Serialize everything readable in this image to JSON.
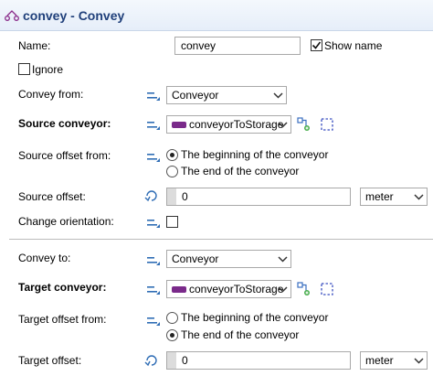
{
  "header": {
    "title": "convey - Convey",
    "icon": "convey-block-icon"
  },
  "name_row": {
    "label": "Name:",
    "value": "convey",
    "show_name_label": "Show name",
    "show_name_checked": true
  },
  "ignore": {
    "label": "Ignore",
    "checked": false
  },
  "convey_from": {
    "label": "Convey from:",
    "value": "Conveyor"
  },
  "source_conveyor": {
    "label": "Source conveyor:",
    "value": "conveyorToStorage"
  },
  "source_offset_from": {
    "label": "Source offset from:",
    "options": [
      "The beginning of the conveyor",
      "The end of the conveyor"
    ],
    "selected": 0
  },
  "source_offset": {
    "label": "Source offset:",
    "value": "0",
    "unit": "meter"
  },
  "change_orientation": {
    "label": "Change orientation:",
    "checked": false
  },
  "convey_to": {
    "label": "Convey to:",
    "value": "Conveyor"
  },
  "target_conveyor": {
    "label": "Target conveyor:",
    "value": "conveyorToStorage"
  },
  "target_offset_from": {
    "label": "Target offset from:",
    "options": [
      "The beginning of the conveyor",
      "The end of the conveyor"
    ],
    "selected": 1
  },
  "target_offset": {
    "label": "Target offset:",
    "value": "0",
    "unit": "meter"
  },
  "colors": {
    "title": "#1f3f7a",
    "header_bg": "#e6eef9",
    "param_icon": "#2f6db5",
    "agent_tag": "#7a2a8a",
    "pick_icon": "#3a6fc0"
  }
}
